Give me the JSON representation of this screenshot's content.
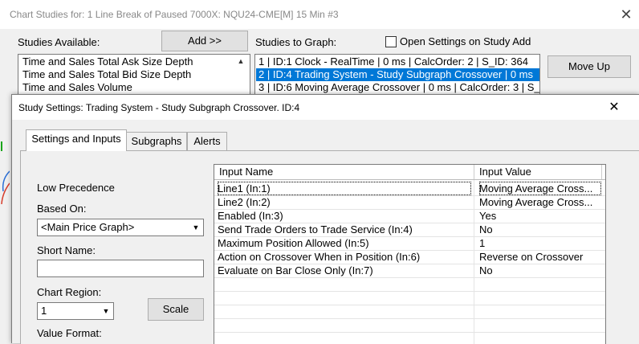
{
  "back_window": {
    "title": "Chart Studies for: 1 Line Break of Paused 7000X: NQU24-CME[M]  15 Min  #3",
    "close_glyph": "✕",
    "studies_available_label": "Studies Available:",
    "add_button": "Add >>",
    "studies_to_graph_label": "Studies to Graph:",
    "open_settings_label": "Open Settings on Study Add",
    "open_settings_checked": false,
    "available": [
      "Time and Sales Total Ask Size Depth",
      "Time and Sales Total Bid Size Depth",
      "Time and Sales Volume"
    ],
    "to_graph": [
      "1 | ID:1  Clock - RealTime | 0 ms | CalcOrder: 2 | S_ID: 364",
      "2 | ID:4  Trading System - Study Subgraph Crossover | 0 ms",
      "3 | ID:6  Moving Average Crossover | 0 ms | CalcOrder: 3 | S_"
    ],
    "selected_index": 1,
    "move_up_button": "Move Up"
  },
  "dialog": {
    "title": "Study Settings: Trading System - Study Subgraph Crossover. ID:4",
    "close_glyph": "✕",
    "tabs": [
      "Settings and Inputs",
      "Subgraphs",
      "Alerts"
    ],
    "active_tab": 0,
    "low_precedence_label": "Low Precedence",
    "based_on_label": "Based On:",
    "based_on_value": "<Main Price Graph>",
    "short_name_label": "Short Name:",
    "short_name_value": "",
    "chart_region_label": "Chart Region:",
    "chart_region_value": "1",
    "scale_button": "Scale",
    "value_format_label": "Value Format:",
    "grid": {
      "col_name": "Input Name",
      "col_value": "Input Value",
      "rows": [
        {
          "name": "Line1   (In:1)",
          "value": "Moving Average Cross..."
        },
        {
          "name": "Line2   (In:2)",
          "value": "Moving Average Cross..."
        },
        {
          "name": "Enabled   (In:3)",
          "value": "Yes"
        },
        {
          "name": "Send Trade Orders to Trade Service   (In:4)",
          "value": "No"
        },
        {
          "name": "Maximum Position Allowed   (In:5)",
          "value": "1"
        },
        {
          "name": "Action on Crossover When in Position   (In:6)",
          "value": "Reverse on Crossover"
        },
        {
          "name": "Evaluate on Bar Close Only   (In:7)",
          "value": "No"
        }
      ]
    }
  },
  "colors": {
    "selection": "#0078d7",
    "window_bg": "#f0f0f0",
    "button_bg": "#e1e1e1"
  },
  "icons": {
    "dropdown": "chevron-down-icon",
    "close": "close-icon",
    "scroll_up": "scroll-up-icon"
  }
}
